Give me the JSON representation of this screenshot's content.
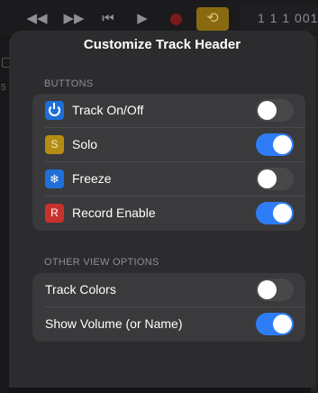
{
  "transport": {
    "rewind_icon": "rewind-icon",
    "forward_icon": "fast-forward-icon",
    "start_icon": "go-to-start-icon",
    "play_icon": "play-icon",
    "record_icon": "record-icon",
    "cycle_icon": "cycle-icon",
    "lcd_value": "1 1 1 001"
  },
  "popover": {
    "title": "Customize Track Header",
    "sections": {
      "buttons": {
        "header": "BUTTONS",
        "items": [
          {
            "label": "Track On/Off",
            "icon": "power-icon",
            "glyph": "",
            "on": false
          },
          {
            "label": "Solo",
            "icon": "solo-icon",
            "glyph": "S",
            "on": true
          },
          {
            "label": "Freeze",
            "icon": "freeze-icon",
            "glyph": "❄",
            "on": false
          },
          {
            "label": "Record Enable",
            "icon": "record-enable-icon",
            "glyph": "R",
            "on": true
          }
        ]
      },
      "other": {
        "header": "OTHER VIEW OPTIONS",
        "items": [
          {
            "label": "Track Colors",
            "on": false
          },
          {
            "label": "Show Volume (or Name)",
            "on": true
          }
        ]
      }
    }
  },
  "colors": {
    "toggle_on": "#2f7df6",
    "toggle_off": "#48484a",
    "popover_bg": "#2c2c2e",
    "group_bg": "#3a3a3c"
  }
}
